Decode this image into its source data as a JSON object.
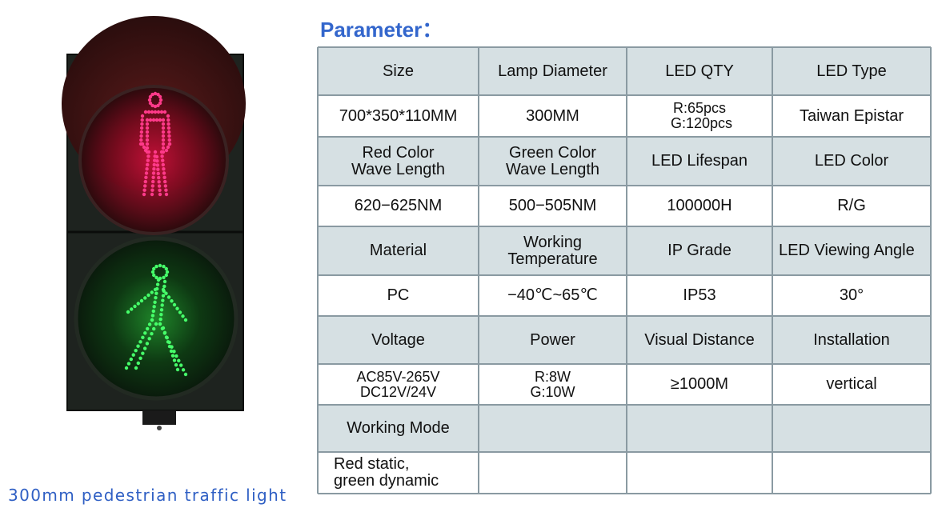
{
  "title": "Parameter：",
  "caption": "300mm pedestrian traffic light",
  "colors": {
    "title": "#3366cc",
    "caption": "#2f5fc4",
    "header_bg": "#d6e0e3",
    "grid_line": "#8a9aa2",
    "red_led": "#ff3a8a",
    "green_led": "#46ff6a"
  },
  "product_image": {
    "description": "pedestrian traffic light with red standing figure and green walking figure",
    "top_signal": "red-standing-figure",
    "bottom_signal": "green-walking-figure"
  },
  "table": {
    "rows": [
      {
        "type": "header",
        "cells": [
          "Size",
          "Lamp Diameter",
          "LED QTY",
          "LED Type"
        ]
      },
      {
        "type": "value",
        "cells": [
          "700*350*110MM",
          "300MM",
          "R:65pcs\n G:120pcs",
          "Taiwan Epistar"
        ]
      },
      {
        "type": "header",
        "cells": [
          "Red Color\nWave Length",
          "Green Color\nWave Length",
          "LED Lifespan",
          "LED Color"
        ]
      },
      {
        "type": "value",
        "cells": [
          "620−625NM",
          "500−505NM",
          "100000H",
          "R/G"
        ]
      },
      {
        "type": "header",
        "cells": [
          "Material",
          "Working\nTemperature",
          "IP Grade",
          "LED Viewing Angle"
        ]
      },
      {
        "type": "value",
        "cells": [
          "PC",
          "−40℃~65℃",
          "IP53",
          "30°"
        ]
      },
      {
        "type": "header",
        "cells": [
          "Voltage",
          "Power",
          "Visual Distance",
          "Installation"
        ]
      },
      {
        "type": "value",
        "cells": [
          "AC85V-265V\nDC12V/24V",
          "R:8W\nG:10W",
          "≥1000M",
          "vertical"
        ]
      },
      {
        "type": "header",
        "cells": [
          "Working Mode",
          "",
          "",
          ""
        ]
      },
      {
        "type": "value",
        "cells": [
          "Red static,\ngreen dynamic",
          "",
          "",
          ""
        ]
      }
    ]
  }
}
